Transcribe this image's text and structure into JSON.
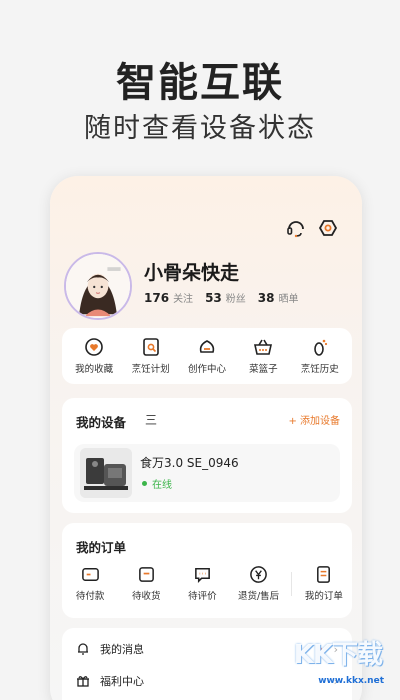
{
  "promo": {
    "title": "智能互联",
    "subtitle": "随时查看设备状态"
  },
  "header_icons": [
    "headset-icon",
    "settings-icon"
  ],
  "profile": {
    "username": "小骨朵快走",
    "stats": [
      {
        "value": "176",
        "label": "关注"
      },
      {
        "value": "53",
        "label": "粉丝"
      },
      {
        "value": "38",
        "label": "晒单"
      }
    ]
  },
  "quick_actions": [
    {
      "label": "我的收藏",
      "icon": "heart-icon"
    },
    {
      "label": "烹饪计划",
      "icon": "plan-icon"
    },
    {
      "label": "创作中心",
      "icon": "create-icon"
    },
    {
      "label": "菜篮子",
      "icon": "basket-icon"
    },
    {
      "label": "烹饪历史",
      "icon": "history-icon"
    }
  ],
  "devices": {
    "title": "我的设备",
    "menu_glyph": "三",
    "add_label": "+ 添加设备",
    "items": [
      {
        "name": "食万3.0 SE_0946",
        "status": "在线"
      }
    ]
  },
  "orders": {
    "title": "我的订单",
    "items": [
      {
        "label": "待付款",
        "icon": "wallet-icon"
      },
      {
        "label": "待收货",
        "icon": "package-icon"
      },
      {
        "label": "待评价",
        "icon": "comment-icon"
      },
      {
        "label": "退货/售后",
        "icon": "refund-icon"
      },
      {
        "label": "我的订单",
        "icon": "order-list-icon"
      }
    ]
  },
  "menu_list": [
    {
      "label": "我的消息",
      "icon": "bell-icon"
    },
    {
      "label": "福利中心",
      "icon": "gift-icon"
    }
  ],
  "watermark": {
    "big": "KK下载",
    "url": "www.kkx.net"
  },
  "colors": {
    "accent": "#e8792b",
    "online": "#3bb54a",
    "notice_dot": "#e8452b"
  }
}
